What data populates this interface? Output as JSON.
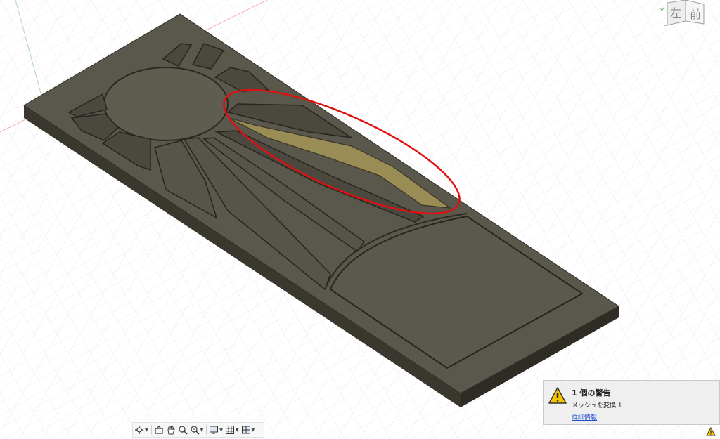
{
  "viewport": {
    "viewcube": {
      "face_left_label": "左",
      "face_front_label": "前",
      "axis_label": "Y"
    }
  },
  "warning_panel": {
    "title": "1 個の警告",
    "message": "メッシュを変換 1",
    "details_link": "詳細情報",
    "icon": "warning-icon"
  },
  "navbar": {
    "items": [
      {
        "name": "orbit-icon",
        "has_menu": true
      },
      {
        "name": "look-at-icon",
        "has_menu": false
      },
      {
        "name": "pan-icon",
        "has_menu": false
      },
      {
        "name": "zoom-icon",
        "has_menu": false
      },
      {
        "name": "fit-icon",
        "has_menu": true
      },
      {
        "name": "display-settings-icon",
        "has_menu": true
      },
      {
        "name": "grid-settings-icon",
        "has_menu": true
      },
      {
        "name": "viewports-icon",
        "has_menu": true
      }
    ]
  },
  "colors": {
    "model_top": "#59564b",
    "model_side": "#3f3c33",
    "highlight_face": "#9a8c55",
    "annotation": "#e01010",
    "grid": "#dcdcdc"
  }
}
